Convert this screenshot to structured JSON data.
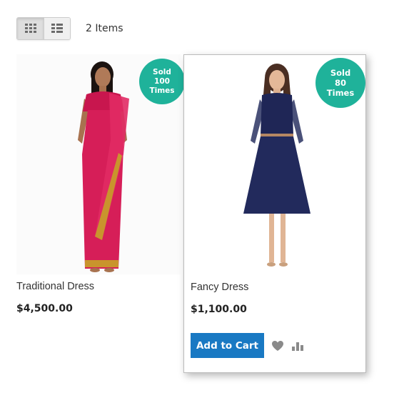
{
  "toolbar": {
    "grid_icon": "grid-view-icon",
    "list_icon": "list-view-icon",
    "items_count": "2 Items"
  },
  "products": [
    {
      "name": "Traditional Dress",
      "price": "$4,500.00",
      "badge": [
        "Sold",
        "100",
        "Times"
      ]
    },
    {
      "name": "Fancy Dress",
      "price": "$1,100.00",
      "badge": [
        "Sold",
        "80",
        "Times"
      ],
      "add_to_cart_label": "Add to Cart",
      "wishlist_icon": "heart-icon",
      "compare_icon": "bar-chart-icon"
    }
  ],
  "colors": {
    "badge": "#1fb29a",
    "primary_button": "#1979c3"
  }
}
